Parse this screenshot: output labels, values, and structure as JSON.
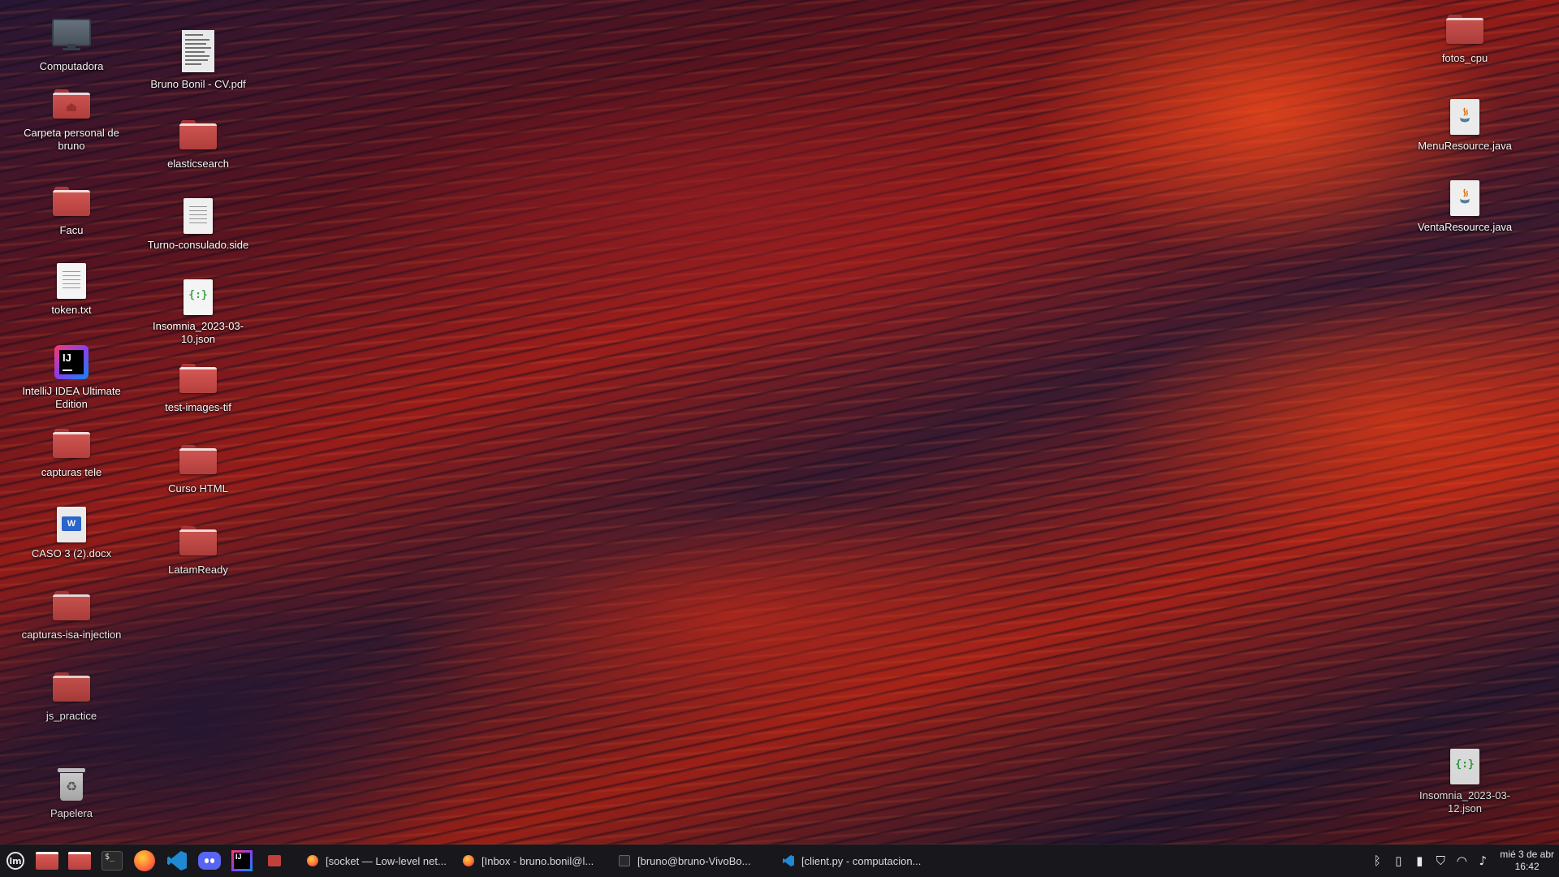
{
  "desktop": {
    "col1": [
      {
        "label": "Computadora",
        "icon": "computer-icon"
      },
      {
        "label": "Carpeta personal de bruno",
        "icon": "home-folder-icon"
      },
      {
        "label": "Facu",
        "icon": "folder-icon"
      },
      {
        "label": "token.txt",
        "icon": "text-file-icon"
      },
      {
        "label": "IntelliJ IDEA Ultimate Edition",
        "icon": "intellij-icon"
      },
      {
        "label": "capturas tele",
        "icon": "folder-icon"
      },
      {
        "label": "CASO 3 (2).docx",
        "icon": "word-document-icon"
      },
      {
        "label": "capturas-isa-injection",
        "icon": "folder-icon"
      },
      {
        "label": "js_practice",
        "icon": "folder-icon"
      },
      {
        "label": "Papelera",
        "icon": "trash-icon"
      }
    ],
    "col2": [
      {
        "label": "Bruno Bonil - CV.pdf",
        "icon": "pdf-file-icon"
      },
      {
        "label": "elasticsearch",
        "icon": "folder-icon"
      },
      {
        "label": "Turno-consulado.side",
        "icon": "text-file-icon"
      },
      {
        "label": "Insomnia_2023-03-10.json",
        "icon": "json-file-icon"
      },
      {
        "label": "test-images-tif",
        "icon": "folder-icon"
      },
      {
        "label": "Curso HTML",
        "icon": "folder-icon"
      },
      {
        "label": "LatamReady",
        "icon": "folder-icon"
      }
    ],
    "right": [
      {
        "label": "fotos_cpu",
        "icon": "folder-icon"
      },
      {
        "label": "MenuResource.java",
        "icon": "java-file-icon"
      },
      {
        "label": "VentaResource.java",
        "icon": "java-file-icon"
      },
      {
        "label": "Insomnia_2023-03-12.json",
        "icon": "json-file-icon"
      }
    ]
  },
  "taskbar": {
    "launchers": [
      {
        "name": "menu",
        "icon": "mint-menu-icon"
      },
      {
        "name": "files",
        "icon": "files-icon"
      },
      {
        "name": "files-2",
        "icon": "folder-icon"
      },
      {
        "name": "terminal",
        "icon": "terminal-icon"
      },
      {
        "name": "firefox",
        "icon": "firefox-icon"
      },
      {
        "name": "vscode",
        "icon": "vscode-icon"
      },
      {
        "name": "discord",
        "icon": "discord-icon"
      },
      {
        "name": "intellij",
        "icon": "intellij-icon"
      },
      {
        "name": "folder-small",
        "icon": "folder-icon"
      }
    ],
    "windows": [
      {
        "title": "[socket — Low-level net...",
        "icon": "firefox-icon"
      },
      {
        "title": "[Inbox - bruno.bonil@l...",
        "icon": "thunderbird-icon"
      },
      {
        "title": "[bruno@bruno-VivoBo...",
        "icon": "terminal-icon"
      },
      {
        "title": "[client.py - computacion...",
        "icon": "vscode-icon"
      }
    ],
    "tray": [
      "bluetooth-icon",
      "clipboard-icon",
      "battery-icon",
      "shield-icon",
      "wifi-icon",
      "volume-icon"
    ],
    "clock": {
      "date": "mié  3 de abr",
      "time": "16:42"
    }
  }
}
